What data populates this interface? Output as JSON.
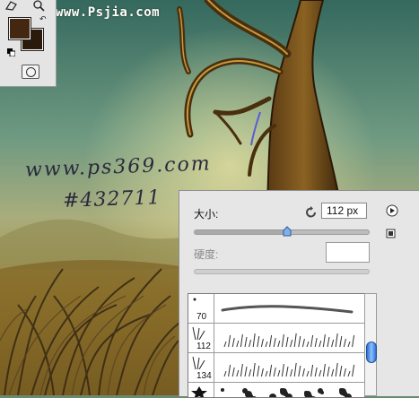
{
  "watermark": "www.Psjia.com",
  "canvas_text": {
    "site": "www.ps369.com",
    "hex": "#432711"
  },
  "colors": {
    "foreground": "#432711",
    "background": "#2a1a0c"
  },
  "tools": {
    "top_icons": [
      "lasso-icon",
      "zoom-icon"
    ],
    "swap_symbol": "↶"
  },
  "brush_panel": {
    "size_label": "大小:",
    "size_value": "112 px",
    "size_slider_level": 0.53,
    "hardness_label": "硬度:",
    "hardness_value": "",
    "presets": [
      {
        "size": "70",
        "type": "soft-round"
      },
      {
        "size": "112",
        "type": "grass"
      },
      {
        "size": "134",
        "type": "grass"
      },
      {
        "size": "",
        "type": "leaf"
      }
    ],
    "scroll_level": 0.58
  }
}
